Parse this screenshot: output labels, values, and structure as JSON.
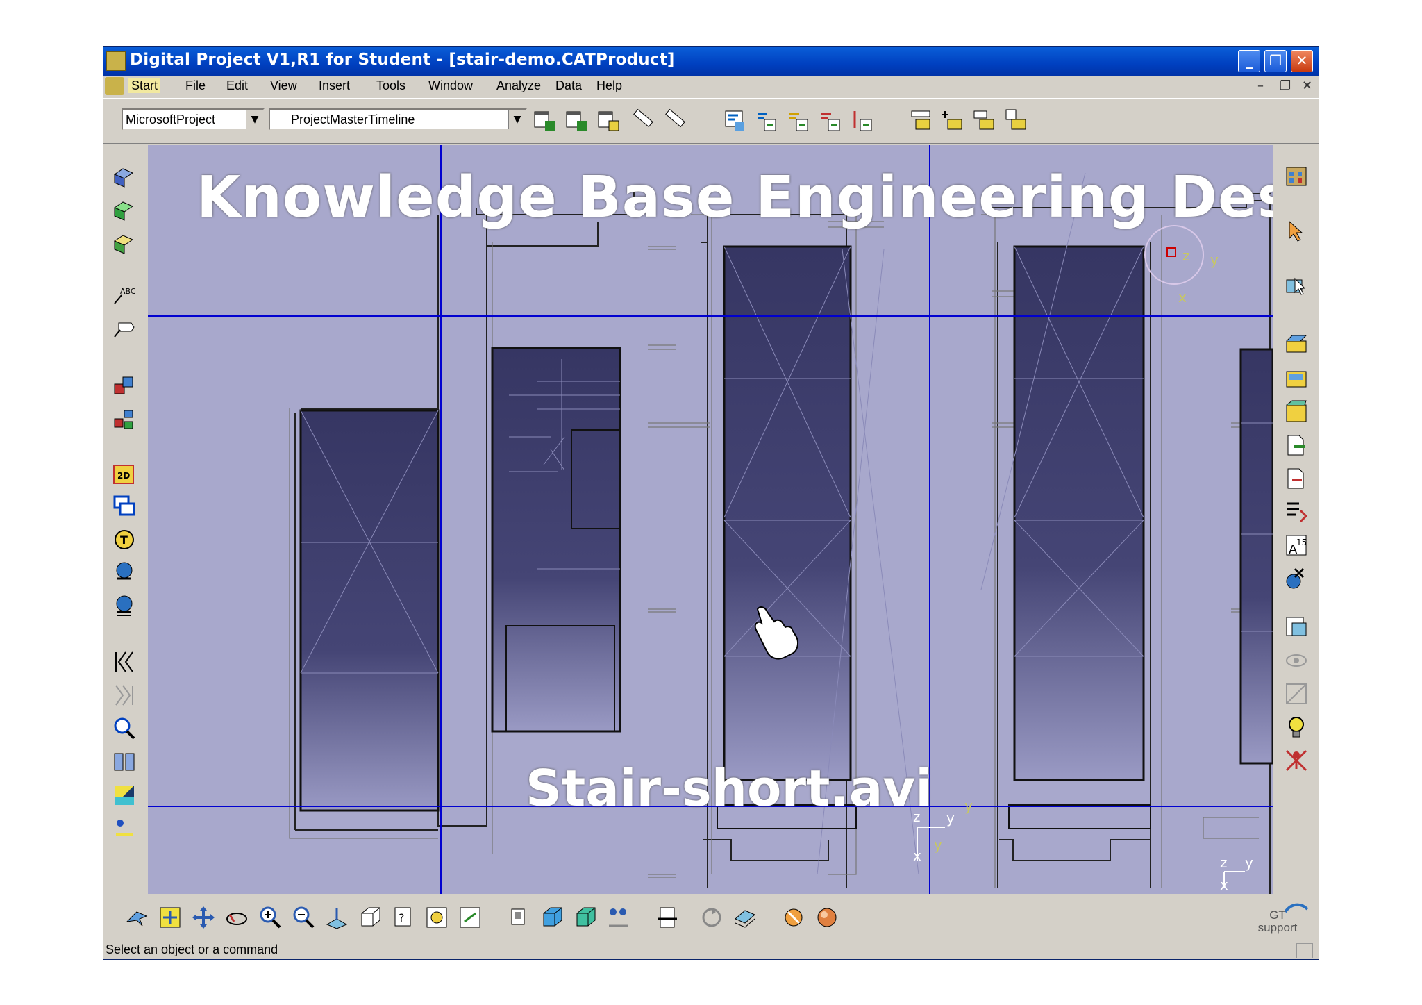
{
  "window": {
    "title": "Digital Project V1,R1 for Student - [stair-demo.CATProduct]",
    "buttons": {
      "minimize": "_",
      "maximize": "❐",
      "close": "✕"
    }
  },
  "menu": {
    "items": [
      "Start",
      "File",
      "Edit",
      "View",
      "Insert",
      "Tools",
      "Window",
      "Analyze",
      "Data",
      "Help"
    ],
    "mdi": {
      "minimize": "–",
      "restore": "❐",
      "close": "✕"
    }
  },
  "toolbar": {
    "combo1": "MicrosoftProject",
    "combo2": "ProjectMasterTimeline",
    "combo_arrow": "▼"
  },
  "overlay": {
    "title": "Knowledge Base Engineering Design",
    "subtitle": "Stair-short.avi"
  },
  "viewport": {
    "axis_labels": [
      "z",
      "y",
      "x",
      "y",
      "z",
      "y",
      "x",
      "y",
      "z",
      "y",
      "x"
    ]
  },
  "bottom": {
    "gt_support": "GT support"
  },
  "status": {
    "text": "Select an object or a command"
  },
  "colors": {
    "title_blue": "#0040c0",
    "viewport_bg": "#a8a8cc",
    "panel_fill": "#3f3f6e",
    "axis_blue": "#0000d0",
    "chrome": "#d4d0c8"
  }
}
